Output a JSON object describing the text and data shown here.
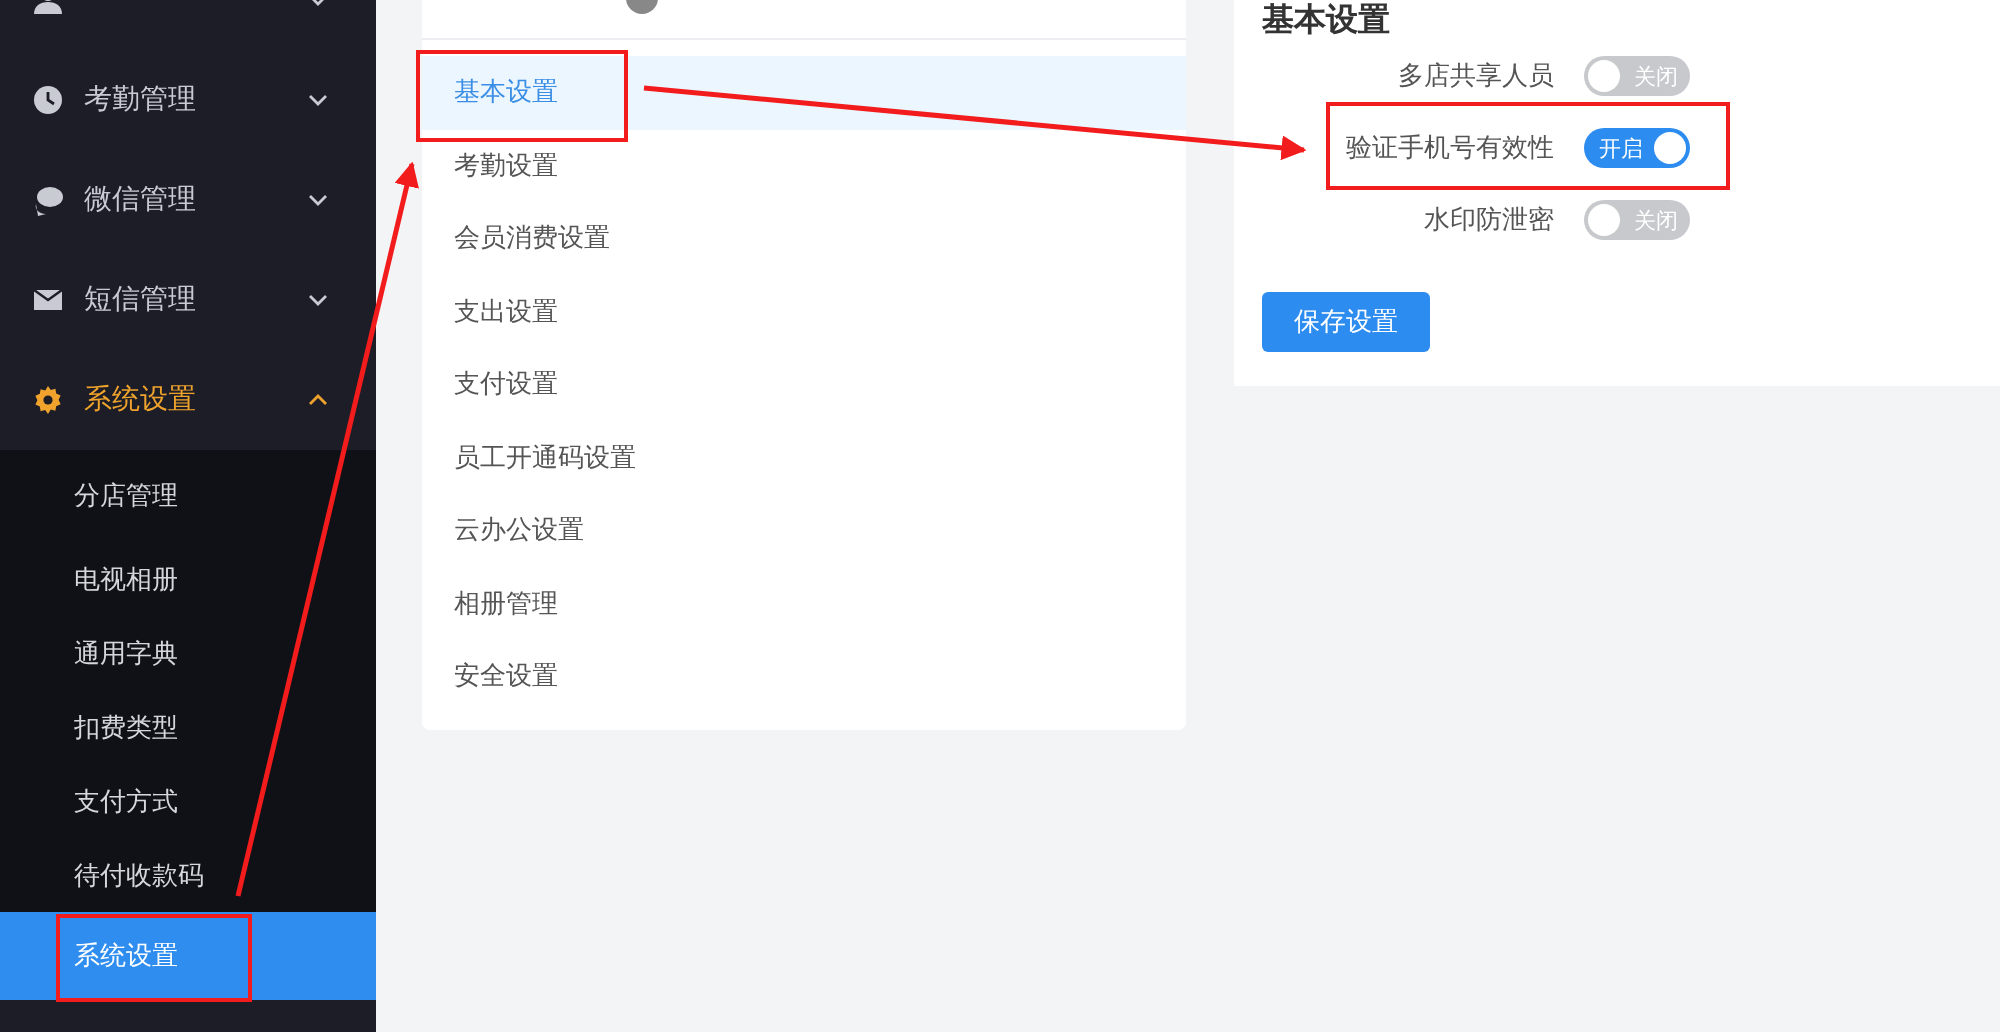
{
  "sidebar": {
    "groups": [
      {
        "kind": "people",
        "expanded": false,
        "selected": false
      },
      {
        "kind": "clock",
        "label": "考勤管理",
        "expanded": false,
        "selected": false
      },
      {
        "kind": "chat",
        "label": "微信管理",
        "expanded": false,
        "selected": false
      },
      {
        "kind": "mail",
        "label": "短信管理",
        "expanded": false,
        "selected": false
      },
      {
        "kind": "gear",
        "label": "系统设置",
        "expanded": true,
        "selected": true,
        "children": [
          {
            "label": "分店管理",
            "selected": false
          },
          {
            "label": "电视相册",
            "selected": false
          },
          {
            "label": "通用字典",
            "selected": false
          },
          {
            "label": "扣费类型",
            "selected": false
          },
          {
            "label": "支付方式",
            "selected": false
          },
          {
            "label": "待付收款码",
            "selected": false
          },
          {
            "label": "系统设置",
            "selected": true
          }
        ]
      }
    ]
  },
  "settings_menu": {
    "items": [
      {
        "label": "基本设置",
        "selected": true
      },
      {
        "label": "考勤设置",
        "selected": false
      },
      {
        "label": "会员消费设置",
        "selected": false
      },
      {
        "label": "支出设置",
        "selected": false
      },
      {
        "label": "支付设置",
        "selected": false
      },
      {
        "label": "员工开通码设置",
        "selected": false
      },
      {
        "label": "云办公设置",
        "selected": false
      },
      {
        "label": "相册管理",
        "selected": false
      },
      {
        "label": "安全设置",
        "selected": false
      }
    ]
  },
  "settings_panel": {
    "title": "基本设置",
    "switches": [
      {
        "label": "多店共享人员",
        "on": false,
        "text": "关闭"
      },
      {
        "label": "验证手机号有效性",
        "on": true,
        "text": "开启"
      },
      {
        "label": "水印防泄密",
        "on": false,
        "text": "关闭"
      }
    ],
    "save_button": "保存设置"
  }
}
